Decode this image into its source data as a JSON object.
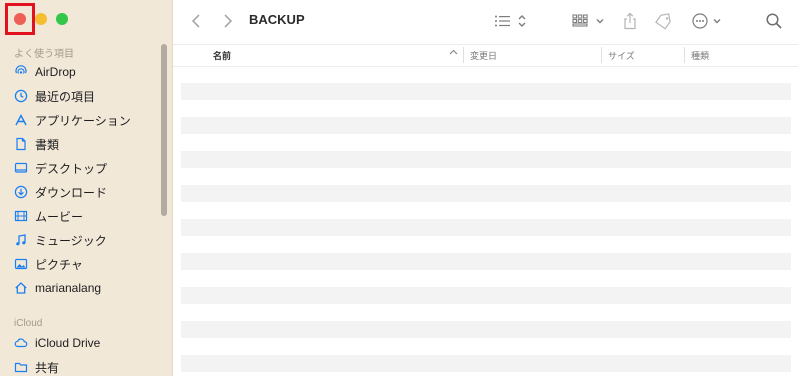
{
  "window": {
    "title": "BACKUP"
  },
  "sidebar": {
    "favorites_heading": "よく使う項目",
    "favorites": [
      {
        "label": "AirDrop",
        "icon": "airdrop-icon"
      },
      {
        "label": "最近の項目",
        "icon": "clock-icon"
      },
      {
        "label": "アプリケーション",
        "icon": "apps-icon"
      },
      {
        "label": "書類",
        "icon": "document-icon"
      },
      {
        "label": "デスクトップ",
        "icon": "desktop-icon"
      },
      {
        "label": "ダウンロード",
        "icon": "download-icon"
      },
      {
        "label": "ムービー",
        "icon": "movie-icon"
      },
      {
        "label": "ミュージック",
        "icon": "music-icon"
      },
      {
        "label": "ピクチャ",
        "icon": "picture-icon"
      },
      {
        "label": "marianalang",
        "icon": "home-icon"
      }
    ],
    "icloud_heading": "iCloud",
    "icloud": [
      {
        "label": "iCloud Drive",
        "icon": "cloud-icon"
      },
      {
        "label": "共有",
        "icon": "shared-folder-icon"
      }
    ]
  },
  "columns": {
    "name": "名前",
    "modified": "変更日",
    "size": "サイズ",
    "kind": "種類"
  },
  "colors": {
    "sidebar_bg": "#f1e8d8",
    "accent": "#1a7ff2",
    "highlight": "#e3121f"
  }
}
